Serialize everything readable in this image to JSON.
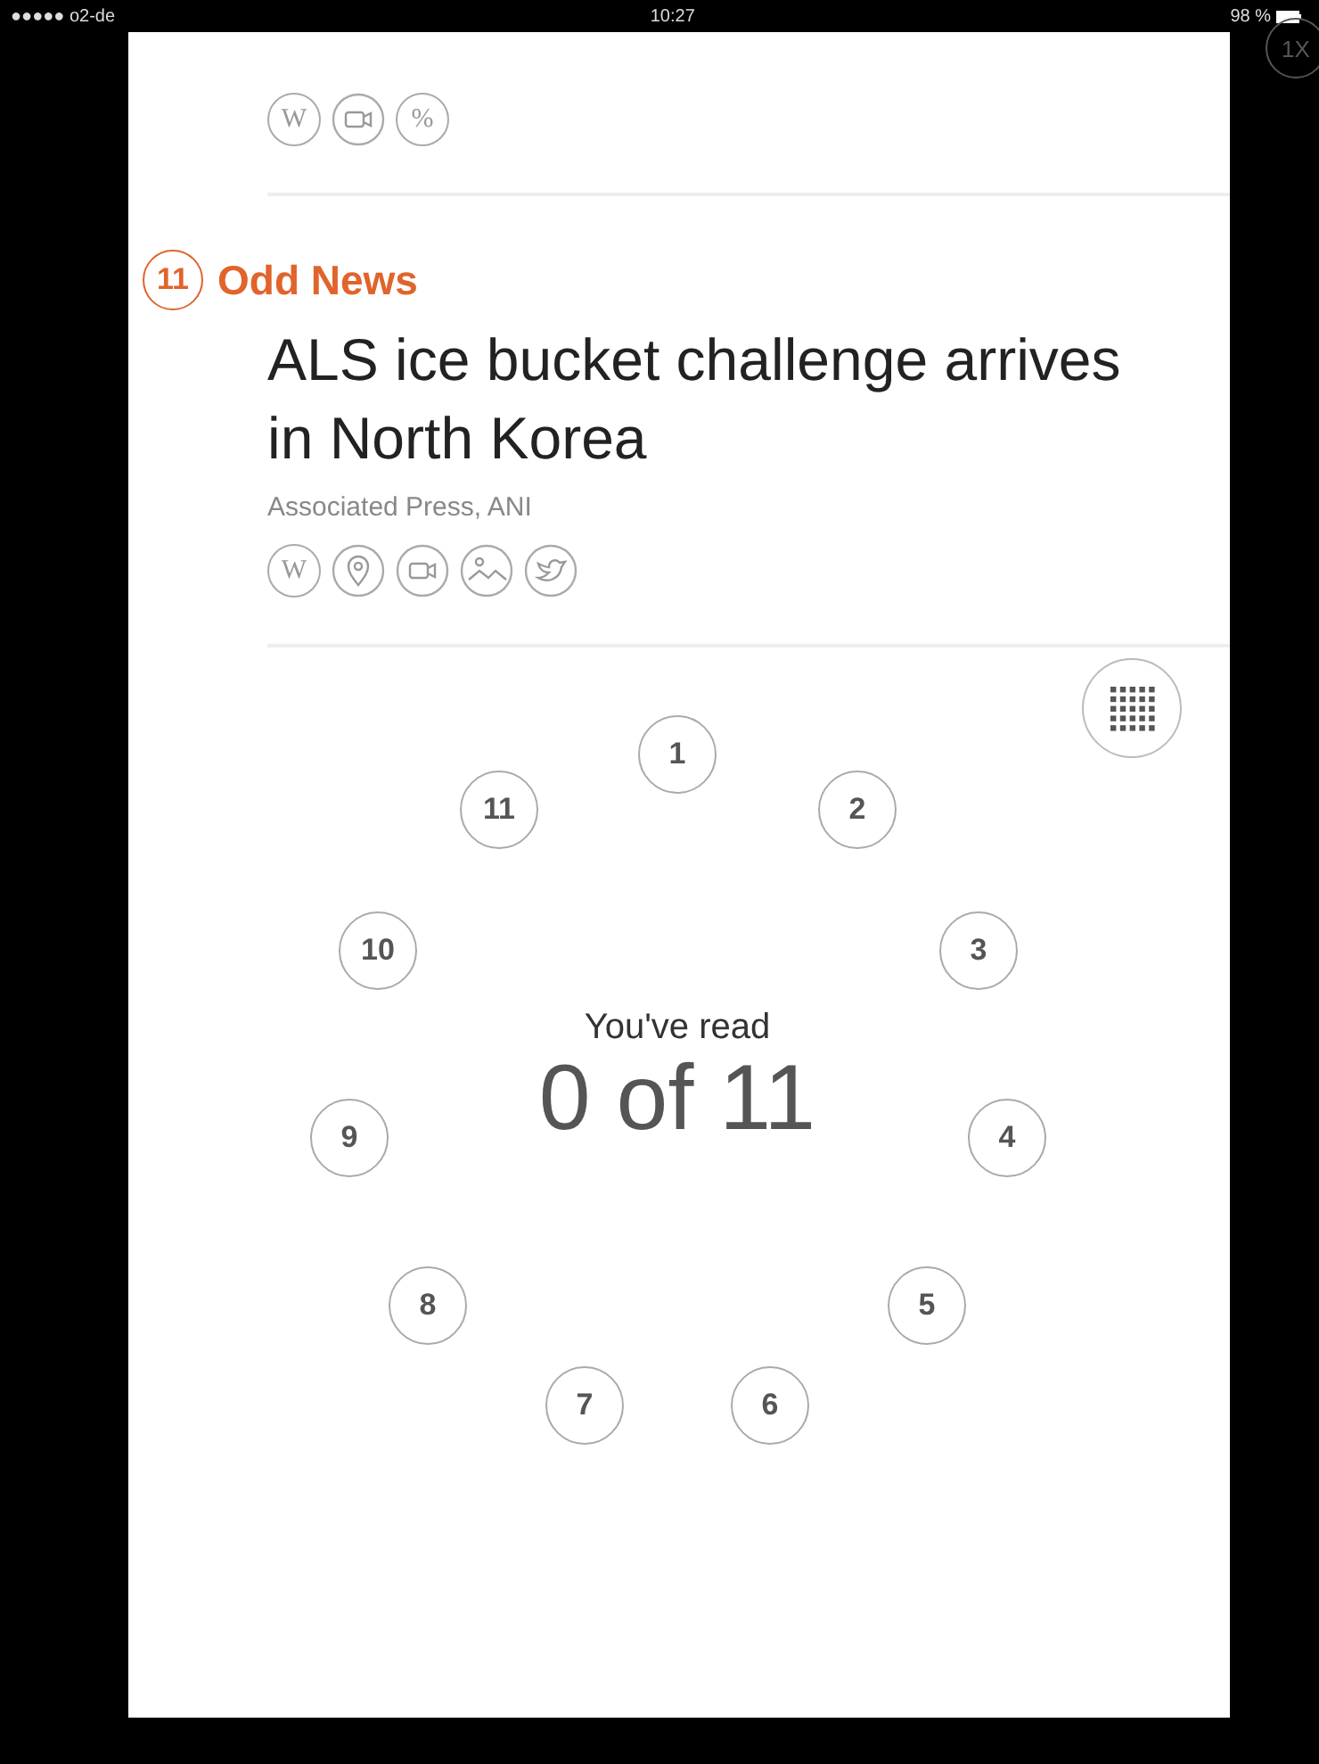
{
  "status_bar": {
    "carrier": "●●●●● o2-de",
    "time": "10:27",
    "battery": "98 %"
  },
  "zoom_button": {
    "label": "1X"
  },
  "previous_article": {
    "icons": [
      {
        "kind": "letter",
        "text": "W"
      },
      {
        "kind": "video"
      },
      {
        "kind": "letter",
        "text": "%"
      }
    ]
  },
  "article": {
    "number": "11",
    "category": "Odd News",
    "headline": "ALS ice bucket challenge arrives in North Korea",
    "sources": "Associated Press, ANI",
    "icons": [
      {
        "kind": "letter",
        "text": "W"
      },
      {
        "kind": "pin"
      },
      {
        "kind": "video"
      },
      {
        "kind": "image"
      },
      {
        "kind": "bird"
      }
    ]
  },
  "progress": {
    "caption": "You've read",
    "count": "0 of 11",
    "items": [
      {
        "label": "1"
      },
      {
        "label": "2"
      },
      {
        "label": "3"
      },
      {
        "label": "4"
      },
      {
        "label": "5"
      },
      {
        "label": "6"
      },
      {
        "label": "7"
      },
      {
        "label": "8"
      },
      {
        "label": "9"
      },
      {
        "label": "10"
      },
      {
        "label": "11"
      }
    ]
  }
}
